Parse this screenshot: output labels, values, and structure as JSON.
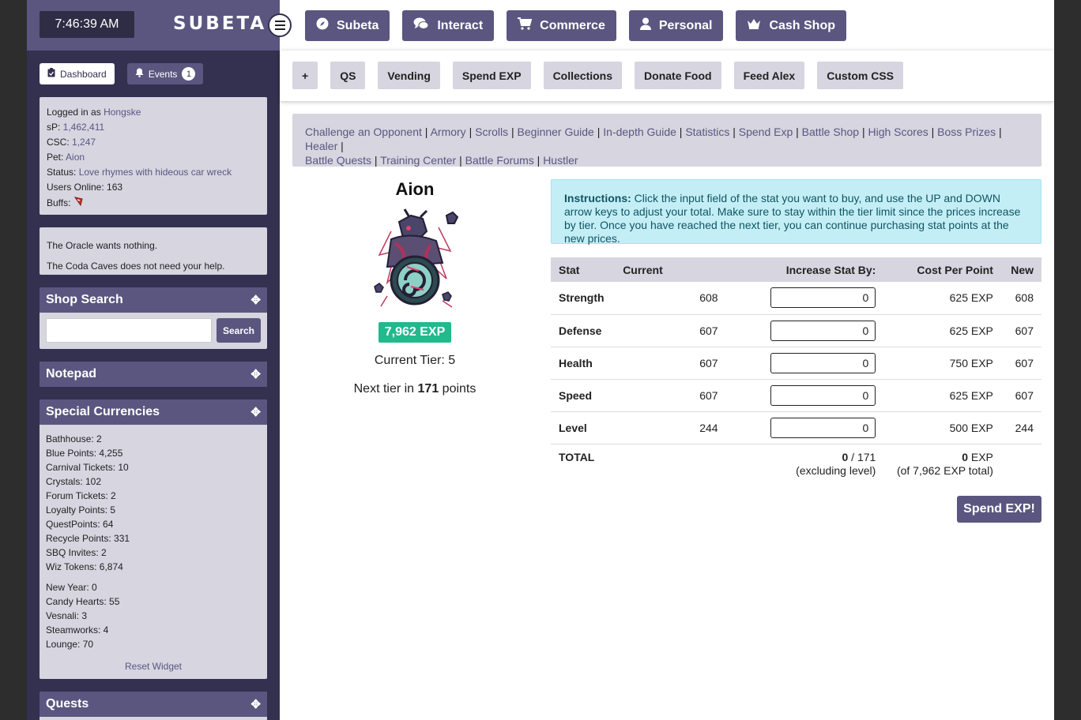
{
  "clock": "7:46:39 AM",
  "logo": "SUBETA",
  "top_nav": [
    {
      "label": "Subeta",
      "icon": "compass-icon"
    },
    {
      "label": "Interact",
      "icon": "chat-icon"
    },
    {
      "label": "Commerce",
      "icon": "cart-icon"
    },
    {
      "label": "Personal",
      "icon": "user-icon"
    },
    {
      "label": "Cash Shop",
      "icon": "crown-icon"
    }
  ],
  "sub_nav": [
    "+",
    "QS",
    "Vending",
    "Spend EXP",
    "Collections",
    "Donate Food",
    "Feed Alex",
    "Custom CSS"
  ],
  "sidebar": {
    "tabs": {
      "dashboard": "Dashboard",
      "events": "Events",
      "events_count": "1"
    },
    "info": {
      "logged_label": "Logged in as ",
      "user": "Hongske",
      "sp_label": "sP: ",
      "sp": "1,462,411",
      "csc_label": "CSC: ",
      "csc": "1,247",
      "pet_label": "Pet: ",
      "pet": "Aion",
      "status_label": "Status: ",
      "status": "Love rhymes with hideous car wreck",
      "online": "Users Online: 163",
      "buffs": "Buffs:"
    },
    "oracle": [
      "The Oracle wants nothing.",
      "The Coda Caves does not need your help."
    ],
    "shop_search": {
      "title": "Shop Search",
      "button": "Search",
      "value": ""
    },
    "notepad": {
      "title": "Notepad"
    },
    "currencies": {
      "title": "Special Currencies",
      "group1": [
        "Bathhouse: 2",
        "Blue Points: 4,255",
        "Carnival Tickets: 10",
        "Crystals: 102",
        "Forum Tickets: 2",
        "Loyalty Points: 5",
        "QuestPoints: 64",
        "Recycle Points: 331",
        "SBQ Invites: 2",
        "Wiz Tokens: 6,874"
      ],
      "group2": [
        "New Year: 0",
        "Candy Hearts: 55",
        "Vesnali: 3",
        "Steamworks: 4",
        "Lounge: 70"
      ],
      "reset": "Reset Widget"
    },
    "quests": {
      "title": "Quests"
    }
  },
  "battle_links": [
    "Challenge an Opponent",
    "Armory",
    "Scrolls",
    "Beginner Guide",
    "In-depth Guide",
    "Statistics",
    "Spend Exp",
    "Battle Shop",
    "High Scores",
    "Boss Prizes",
    "Healer",
    "Battle Quests",
    "Training Center",
    "Battle Forums",
    "Hustler"
  ],
  "pet": {
    "name": "Aion",
    "exp": "7,962 EXP",
    "tier": "Current Tier: 5",
    "next_prefix": "Next tier in ",
    "next_points": "171",
    "next_suffix": " points"
  },
  "instructions": {
    "label": "Instructions:",
    "text": " Click the input field of the stat you want to buy, and use the UP and DOWN arrow keys to adjust your total. Make sure to stay within the tier limit since the prices increase by tier. Once you have reached the next tier, you can continue purchasing stat points at the new prices."
  },
  "table": {
    "headers": [
      "Stat",
      "Current",
      "Increase Stat By:",
      "Cost Per Point",
      "New"
    ],
    "rows": [
      {
        "stat": "Strength",
        "current": "608",
        "increase": "0",
        "cost": "625 EXP",
        "new": "608"
      },
      {
        "stat": "Defense",
        "current": "607",
        "increase": "0",
        "cost": "625 EXP",
        "new": "607"
      },
      {
        "stat": "Health",
        "current": "607",
        "increase": "0",
        "cost": "750 EXP",
        "new": "607"
      },
      {
        "stat": "Speed",
        "current": "607",
        "increase": "0",
        "cost": "625 EXP",
        "new": "607"
      },
      {
        "stat": "Level",
        "current": "244",
        "increase": "0",
        "cost": "500 EXP",
        "new": "244"
      }
    ],
    "total": {
      "label": "TOTAL",
      "points": "0",
      "points_max": " / 171",
      "points_note": "(excluding level)",
      "exp": "0",
      "exp_unit": " EXP",
      "exp_note": "(of 7,962 EXP total)"
    }
  },
  "spend_button": "Spend EXP!",
  "colors": {
    "brand": "#5a5680",
    "sidebar": "#34304f",
    "panel": "#d6d5e0",
    "exp_badge": "#22b98c",
    "info_bg": "#c4eef6"
  }
}
